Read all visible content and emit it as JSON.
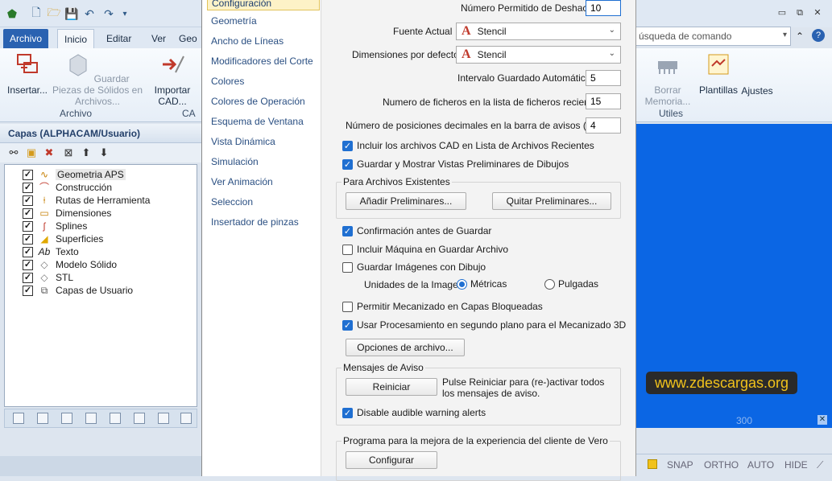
{
  "app": {
    "tabs": [
      "Archivo",
      "Inicio",
      "Editar",
      "Ver",
      "Geo"
    ],
    "ribbon_buttons": [
      "Insertar...",
      "Guardar Piezas de Sólidos en Archivos...",
      "Importar CAD..."
    ],
    "groups": [
      "Archivo",
      "CA"
    ],
    "right_buttons": [
      "Borrar Memoria...",
      "Plantillas",
      "Ajustes"
    ],
    "right_group": "Utiles",
    "command_search_placeholder": "úsqueda de comando",
    "watermark": "www.zdescargas.org",
    "viewport_label": "300",
    "status": [
      "SNAP",
      "ORTHO",
      "AUTO",
      "HIDE"
    ]
  },
  "layers": {
    "title": "Capas (ALPHACAM/Usuario)",
    "items": [
      {
        "label": "Geometria APS",
        "checked": true,
        "icon": "geometry-icon"
      },
      {
        "label": "Construcción",
        "checked": true,
        "icon": "construction-icon"
      },
      {
        "label": "Rutas de Herramienta",
        "checked": true,
        "icon": "toolpath-icon"
      },
      {
        "label": "Dimensiones",
        "checked": true,
        "icon": "dimension-icon"
      },
      {
        "label": "Splines",
        "checked": true,
        "icon": "spline-icon"
      },
      {
        "label": "Superficies",
        "checked": true,
        "icon": "surface-icon"
      },
      {
        "label": "Texto",
        "checked": true,
        "icon": "text-icon"
      },
      {
        "label": "Modelo Sólido",
        "checked": true,
        "icon": "solid-icon"
      },
      {
        "label": "STL",
        "checked": true,
        "icon": "stl-icon"
      },
      {
        "label": "Capas de Usuario",
        "checked": true,
        "icon": "user-layers-icon"
      }
    ]
  },
  "nav": {
    "items": [
      "Configuración",
      "Geometría",
      "Ancho de Líneas",
      "Modificadores del Corte",
      "Colores",
      "Colores de Operación",
      "Esquema de Ventana",
      "Vista Dinámica",
      "Simulación",
      "Ver Animación",
      "Seleccion",
      "Insertador de pinzas"
    ]
  },
  "settings": {
    "undo_label": "Número Permitido de Deshacer",
    "undo_value": "10",
    "font_label": "Fuente Actual",
    "font_value": "Stencil",
    "dim_label": "Dimensiones por defecto",
    "dim_value": "Stencil",
    "autosave_label": "Intervalo Guardado Automático",
    "autosave_value": "5",
    "recent_label": "Numero de ficheros en la lista de ficheros recientes",
    "recent_value": "15",
    "decimals_label": "Número de posiciones decimales en la barra de avisos (Min =",
    "decimals_value": "4",
    "cb_include_cad": "Incluir los archivos CAD en Lista de Archivos Recientes",
    "cb_previews": "Guardar y Mostrar Vistas Preliminares de Dibujos",
    "existing_group": "Para Archivos Existentes",
    "btn_add_previews": "Añadir Preliminares...",
    "btn_remove_previews": "Quitar Preliminares...",
    "cb_confirm": "Confirmación antes de Guardar",
    "cb_machine": "Incluir Máquina en Guardar Archivo",
    "cb_images": "Guardar Imágenes con Dibujo",
    "units_label": "Unidades de la Imagen",
    "units_metric": "Métricas",
    "units_inch": "Pulgadas",
    "cb_locked": "Permitir Mecanizado en Capas Bloqueadas",
    "cb_background": "Usar Procesamiento en segundo plano para el Mecanizado 3D",
    "btn_file_options": "Opciones de archivo...",
    "warnings_group": "Mensajes de Aviso",
    "btn_reset": "Reiniciar",
    "reset_note": "Pulse Reiniciar para (re-)activar todos los mensajes de aviso.",
    "cb_audible": "Disable audible warning alerts",
    "program_group": "Programa para la mejora de la experiencia del cliente de Vero",
    "btn_configure": "Configurar"
  },
  "colors": {
    "accent": "#1f6fd1",
    "viewport": "#0b66e4",
    "file_tab": "#2a62b1",
    "nav_active": "#fdf2c7"
  }
}
